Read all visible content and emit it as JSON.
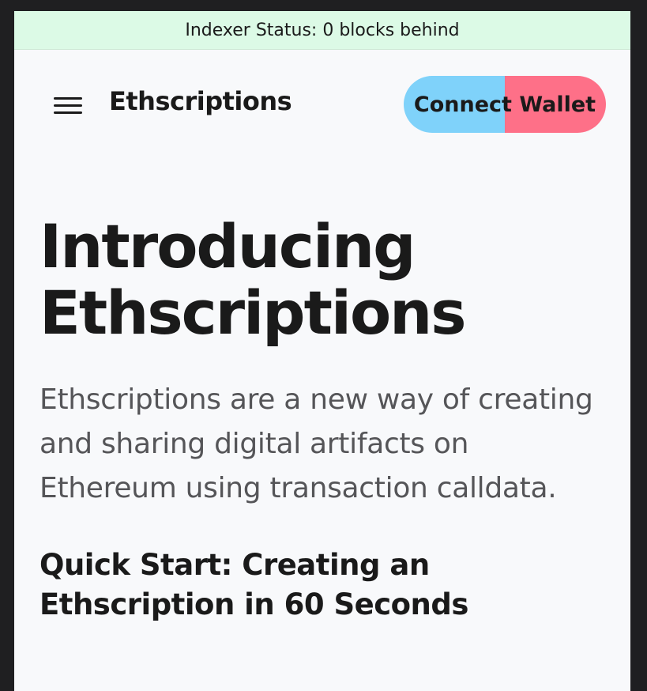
{
  "status_bar": {
    "text": "Indexer Status: 0 blocks behind"
  },
  "header": {
    "menu_icon": "hamburger-menu-icon",
    "brand": "Ethscriptions",
    "connect_button": "Connect Wallet"
  },
  "hero": {
    "title": "Introducing Ethscriptions",
    "description": "Ethscriptions are a new way of creating and sharing digital artifacts on Ethereum using transaction calldata."
  },
  "quick_start": {
    "title": "Quick Start: Creating an Ethscription in 60 Seconds"
  },
  "colors": {
    "status_bg": "#dcfae6",
    "page_bg": "#f8f9fb",
    "button_left": "#7fd2fa",
    "button_right": "#fe7088"
  }
}
